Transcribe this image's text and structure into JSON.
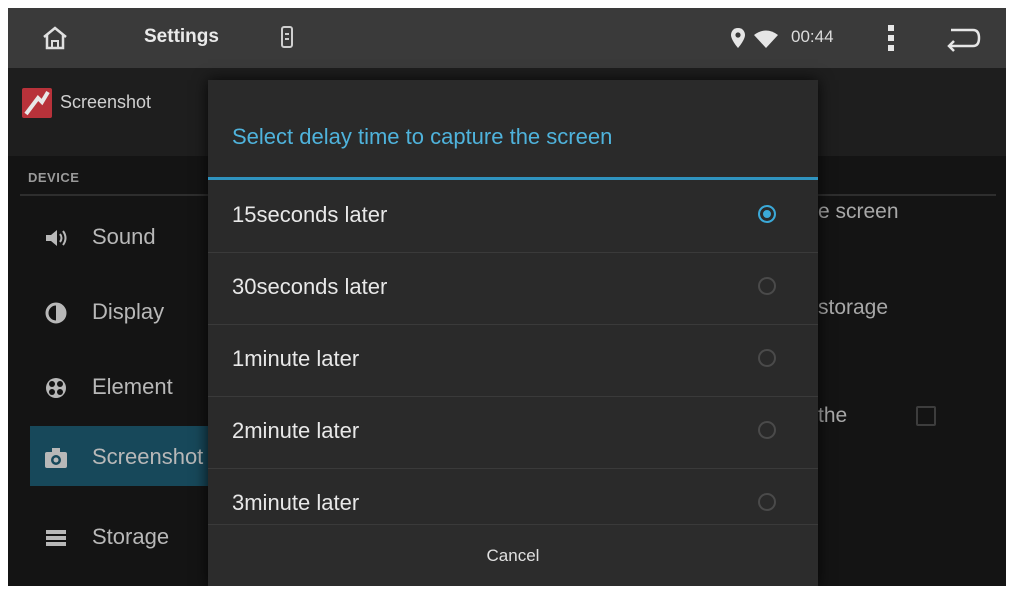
{
  "status_bar": {
    "title": "Settings",
    "time": "00:44",
    "icons": [
      "home-icon",
      "phone-icon",
      "location-icon",
      "wifi-icon",
      "more-vert-icon",
      "back-icon"
    ]
  },
  "background": {
    "subheader_title": "Screenshot",
    "section_label": "DEVICE",
    "nav_items": [
      {
        "label": "Sound",
        "icon": "sound-icon"
      },
      {
        "label": "Display",
        "icon": "display-icon"
      },
      {
        "label": "Element",
        "icon": "element-icon"
      },
      {
        "label": "Screenshot",
        "icon": "camera-icon",
        "active": true
      },
      {
        "label": "Storage",
        "icon": "storage-icon"
      }
    ],
    "right_fragments": [
      "e screen",
      "storage",
      "the"
    ]
  },
  "dialog": {
    "title": "Select delay time to capture the screen",
    "options": [
      {
        "label": "15seconds later",
        "selected": true
      },
      {
        "label": "30seconds later",
        "selected": false
      },
      {
        "label": "1minute later",
        "selected": false
      },
      {
        "label": "2minute later",
        "selected": false
      },
      {
        "label": "3minute later",
        "selected": false
      }
    ],
    "cancel_label": "Cancel"
  },
  "colors": {
    "accent": "#3ba9d8",
    "title_accent": "#4fb3dc",
    "active_nav": "#17485a"
  }
}
